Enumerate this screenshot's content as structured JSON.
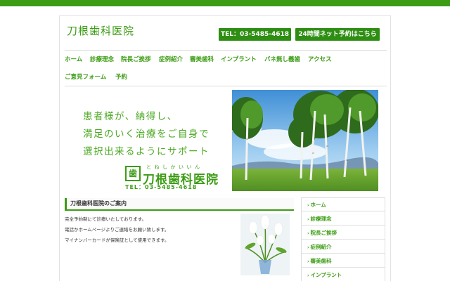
{
  "header": {
    "logo_text": "刀根歯科医院",
    "tel_button": "TEL：03-5485-4618",
    "reserve_button": "24時間ネット予約はこちら"
  },
  "nav": {
    "items": [
      {
        "label": "ホーム"
      },
      {
        "label": "診療理念"
      },
      {
        "label": "院長ご挨拶"
      },
      {
        "label": "症例紹介"
      },
      {
        "label": "審美歯科"
      },
      {
        "label": "インプラント"
      },
      {
        "label": "バネ無し義歯"
      },
      {
        "label": "アクセス"
      },
      {
        "label": "ご意見フォーム"
      },
      {
        "label": "予約"
      }
    ]
  },
  "hero": {
    "slogan_lines": [
      "患者様が、納得し、",
      "満足のいく治療をご自身で",
      "選択出来るようにサポート"
    ],
    "logo_mark": "歯",
    "logo_ruby": "とねしかいいん",
    "logo_name": "刀根歯科医院",
    "logo_tel": "TEL：03-5485-4618"
  },
  "guide": {
    "heading": "刀根歯科医院のご案内",
    "lines": [
      "完全予約制にて診療いたしております。",
      "電話かホームページよりご連絡をお願い致します。",
      "マイナンバーカードが保険証として使用できます。"
    ]
  },
  "sidebar": {
    "items": [
      {
        "label": "ホーム"
      },
      {
        "label": "診療理念"
      },
      {
        "label": "院長ご挨拶"
      },
      {
        "label": "症例紹介"
      },
      {
        "label": "審美歯科"
      },
      {
        "label": "インプラント"
      }
    ]
  },
  "colors": {
    "brand_green": "#3c9c14",
    "button_green": "#2e8e13"
  },
  "icons": {
    "sidebar_arrow": "chevron-right-icon"
  }
}
